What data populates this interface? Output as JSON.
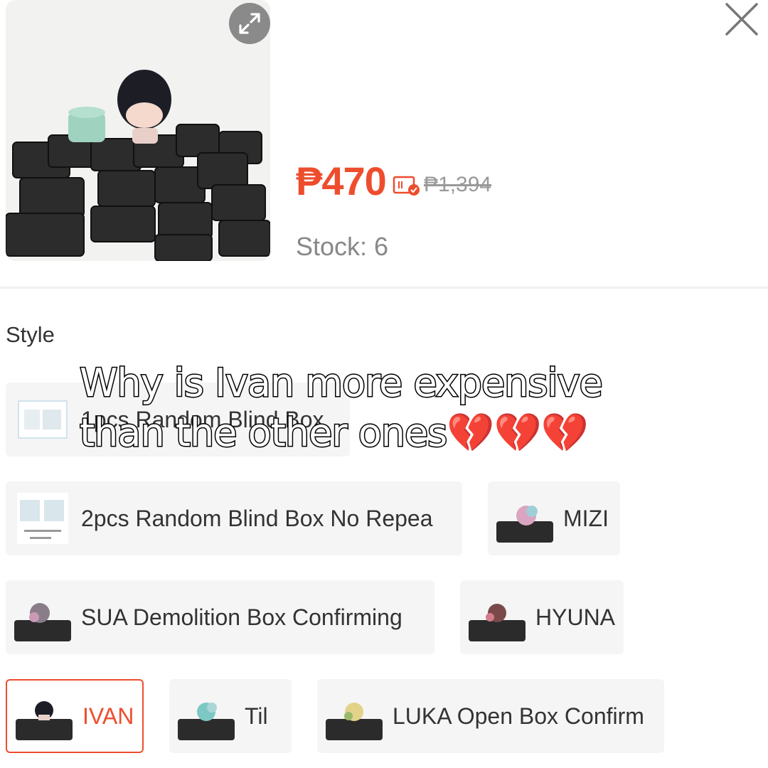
{
  "product": {
    "price": "₱470",
    "original_price": "₱1,394",
    "stock": "Stock: 6"
  },
  "variations": {
    "title": "Style",
    "options": [
      {
        "label": "1pcs Random Blind Box"
      },
      {
        "label": "2pcs Random Blind Box No Repea"
      },
      {
        "label": "MIZI"
      },
      {
        "label": "SUA Demolition Box Confirming"
      },
      {
        "label": "HYUNA"
      },
      {
        "label": "IVAN"
      },
      {
        "label": "Til"
      },
      {
        "label": "LUKA Open Box Confirm"
      }
    ],
    "selected": "IVAN"
  },
  "caption": {
    "line1": "Why is Ivan more expensive",
    "line2": "than the other ones",
    "emoji": "💔💔💔"
  },
  "colors": {
    "accent": "#ee4d2d",
    "chip_bg": "#f5f5f5"
  },
  "icons": [
    "expand-icon",
    "close-icon",
    "voucher-icon"
  ]
}
